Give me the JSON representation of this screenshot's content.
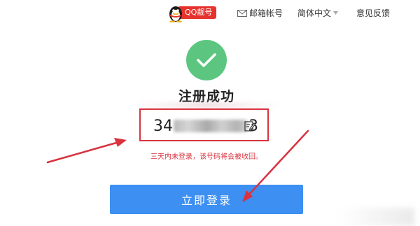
{
  "nav": {
    "qq_badge_label": "QQ靓号",
    "mail_label": "邮箱帐号",
    "language_label": "简体中文",
    "feedback_label": "意见反馈"
  },
  "success": {
    "title": "注册成功",
    "account_prefix": "34",
    "account_suffix": "3",
    "notice": "三天内未登录，该号码将会被收回。",
    "login_button": "立即登录"
  },
  "colors": {
    "success_green": "#5cc680",
    "brand_red": "#e5322d",
    "button_blue": "#3d8ff2",
    "highlight_red": "#d8333f"
  }
}
